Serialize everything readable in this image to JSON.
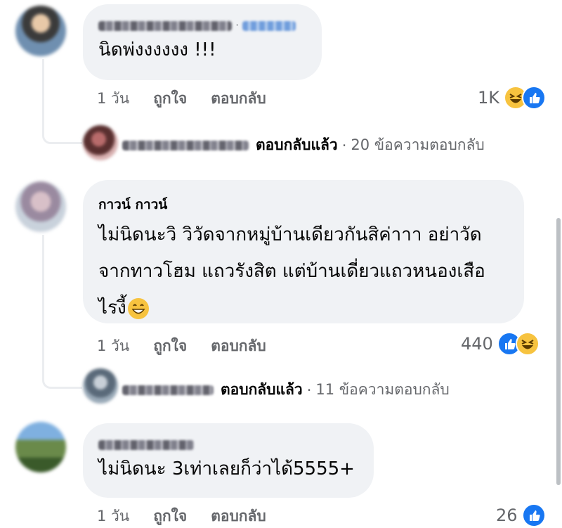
{
  "comments": [
    {
      "text": "นิดพ่งงงงงง !!!",
      "time": "1 วัน",
      "like_label": "ถูกใจ",
      "reply_label": "ตอบกลับ",
      "reaction_count": "1K",
      "reactions": [
        "haha-emoji-icon",
        "like-emoji-icon"
      ],
      "replies": {
        "replied_label": "ตอบกลับแล้ว",
        "dot": "·",
        "count_label": "20 ข้อความตอบกลับ"
      }
    },
    {
      "author": "กาวน์ กาวน์",
      "text_lines": [
        "ไม่นิดนะวิ  วิวัดจากหมู่บ้านเดียวกันสิค่าาา อย่าวัด",
        "จากทาวโฮม แถวรังสิต  แต่บ้านเดี่ยวแถวหนองเสือ",
        "ไรงี้"
      ],
      "time": "1 วัน",
      "like_label": "ถูกใจ",
      "reply_label": "ตอบกลับ",
      "reaction_count": "440",
      "reactions": [
        "like-emoji-icon",
        "haha-emoji-icon"
      ],
      "replies": {
        "replied_label": "ตอบกลับแล้ว",
        "dot": "·",
        "count_label": "11 ข้อความตอบกลับ"
      }
    },
    {
      "text": "ไม่นิดนะ 3เท่าเลยก็ว่าได้5555+",
      "time": "1 วัน",
      "like_label": "ถูกใจ",
      "reply_label": "ตอบกลับ",
      "reaction_count": "26",
      "reactions": [
        "like-emoji-icon"
      ]
    }
  ],
  "colors": {
    "bubble": "#f0f2f5",
    "meta": "#65676b",
    "like_blue": "#1877f2",
    "haha_yellow": "#f7c33f"
  }
}
